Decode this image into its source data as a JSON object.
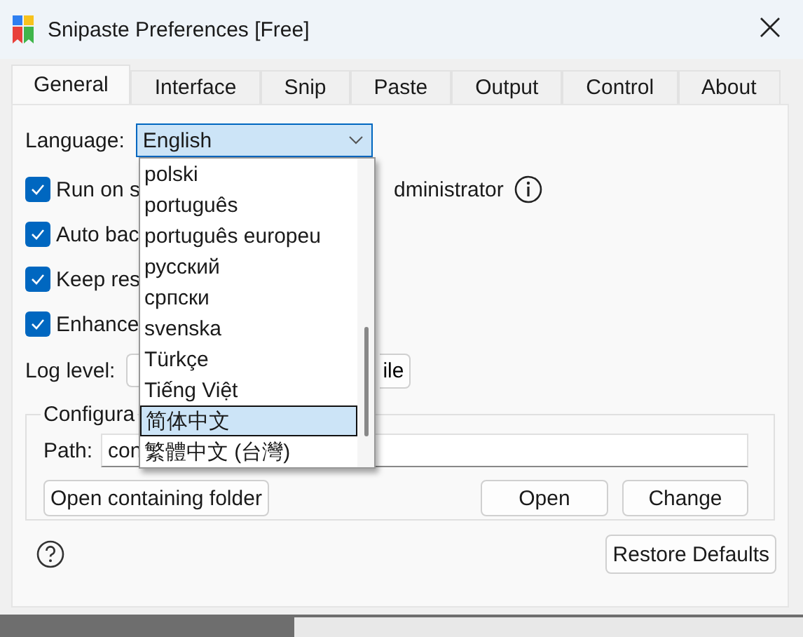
{
  "window": {
    "title": "Snipaste Preferences [Free]"
  },
  "tabs": [
    {
      "label": "General",
      "selected": true
    },
    {
      "label": "Interface",
      "selected": false
    },
    {
      "label": "Snip",
      "selected": false
    },
    {
      "label": "Paste",
      "selected": false
    },
    {
      "label": "Output",
      "selected": false
    },
    {
      "label": "Control",
      "selected": false
    },
    {
      "label": "About",
      "selected": false
    }
  ],
  "language": {
    "label": "Language:",
    "value": "English",
    "expanded": true,
    "options": [
      {
        "label": "polski",
        "selected": false
      },
      {
        "label": "português",
        "selected": false
      },
      {
        "label": "português europeu",
        "selected": false
      },
      {
        "label": "русский",
        "selected": false
      },
      {
        "label": "српски",
        "selected": false
      },
      {
        "label": "svenska",
        "selected": false
      },
      {
        "label": "Türkçe",
        "selected": false
      },
      {
        "label": "Tiếng Việt",
        "selected": false
      },
      {
        "label": "简体中文",
        "selected": true
      },
      {
        "label": "繁體中文 (台灣)",
        "selected": false
      }
    ]
  },
  "options": [
    {
      "label": "Run on s",
      "checked": true,
      "trailing": "dministrator"
    },
    {
      "label": "Auto bac",
      "checked": true
    },
    {
      "label": "Keep res",
      "checked": true
    },
    {
      "label": "Enhance",
      "checked": true
    }
  ],
  "log_level": {
    "label": "Log level:",
    "button": "ile"
  },
  "config": {
    "title": "Configura",
    "path_label": "Path:",
    "path_value": "con",
    "buttons": [
      "Open containing folder",
      "Open",
      "Change"
    ]
  },
  "footer": {
    "button": "Restore Defaults"
  }
}
